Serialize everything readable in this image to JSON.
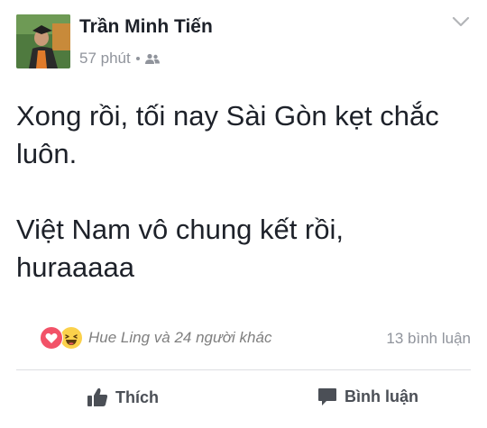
{
  "post": {
    "author": "Trần Minh Tiến",
    "timestamp": "57 phút",
    "privacy_icon": "friends-icon",
    "paragraphs": [
      "Xong rồi, tối nay Sài Gòn kẹt chắc luôn.",
      "Việt Nam vô chung kết rồi, huraaaaa"
    ]
  },
  "reactions": {
    "icons": [
      "love-reaction-icon",
      "haha-reaction-icon"
    ],
    "summary": "Hue Ling và 24 người khác",
    "comments": "13 bình luận"
  },
  "actions": {
    "like_label": "Thích",
    "comment_label": "Bình luận"
  },
  "colors": {
    "text": "#1d2129",
    "muted": "#90949c",
    "love": "#f25268",
    "haha": "#fbd14b",
    "action": "#4b4f56"
  }
}
